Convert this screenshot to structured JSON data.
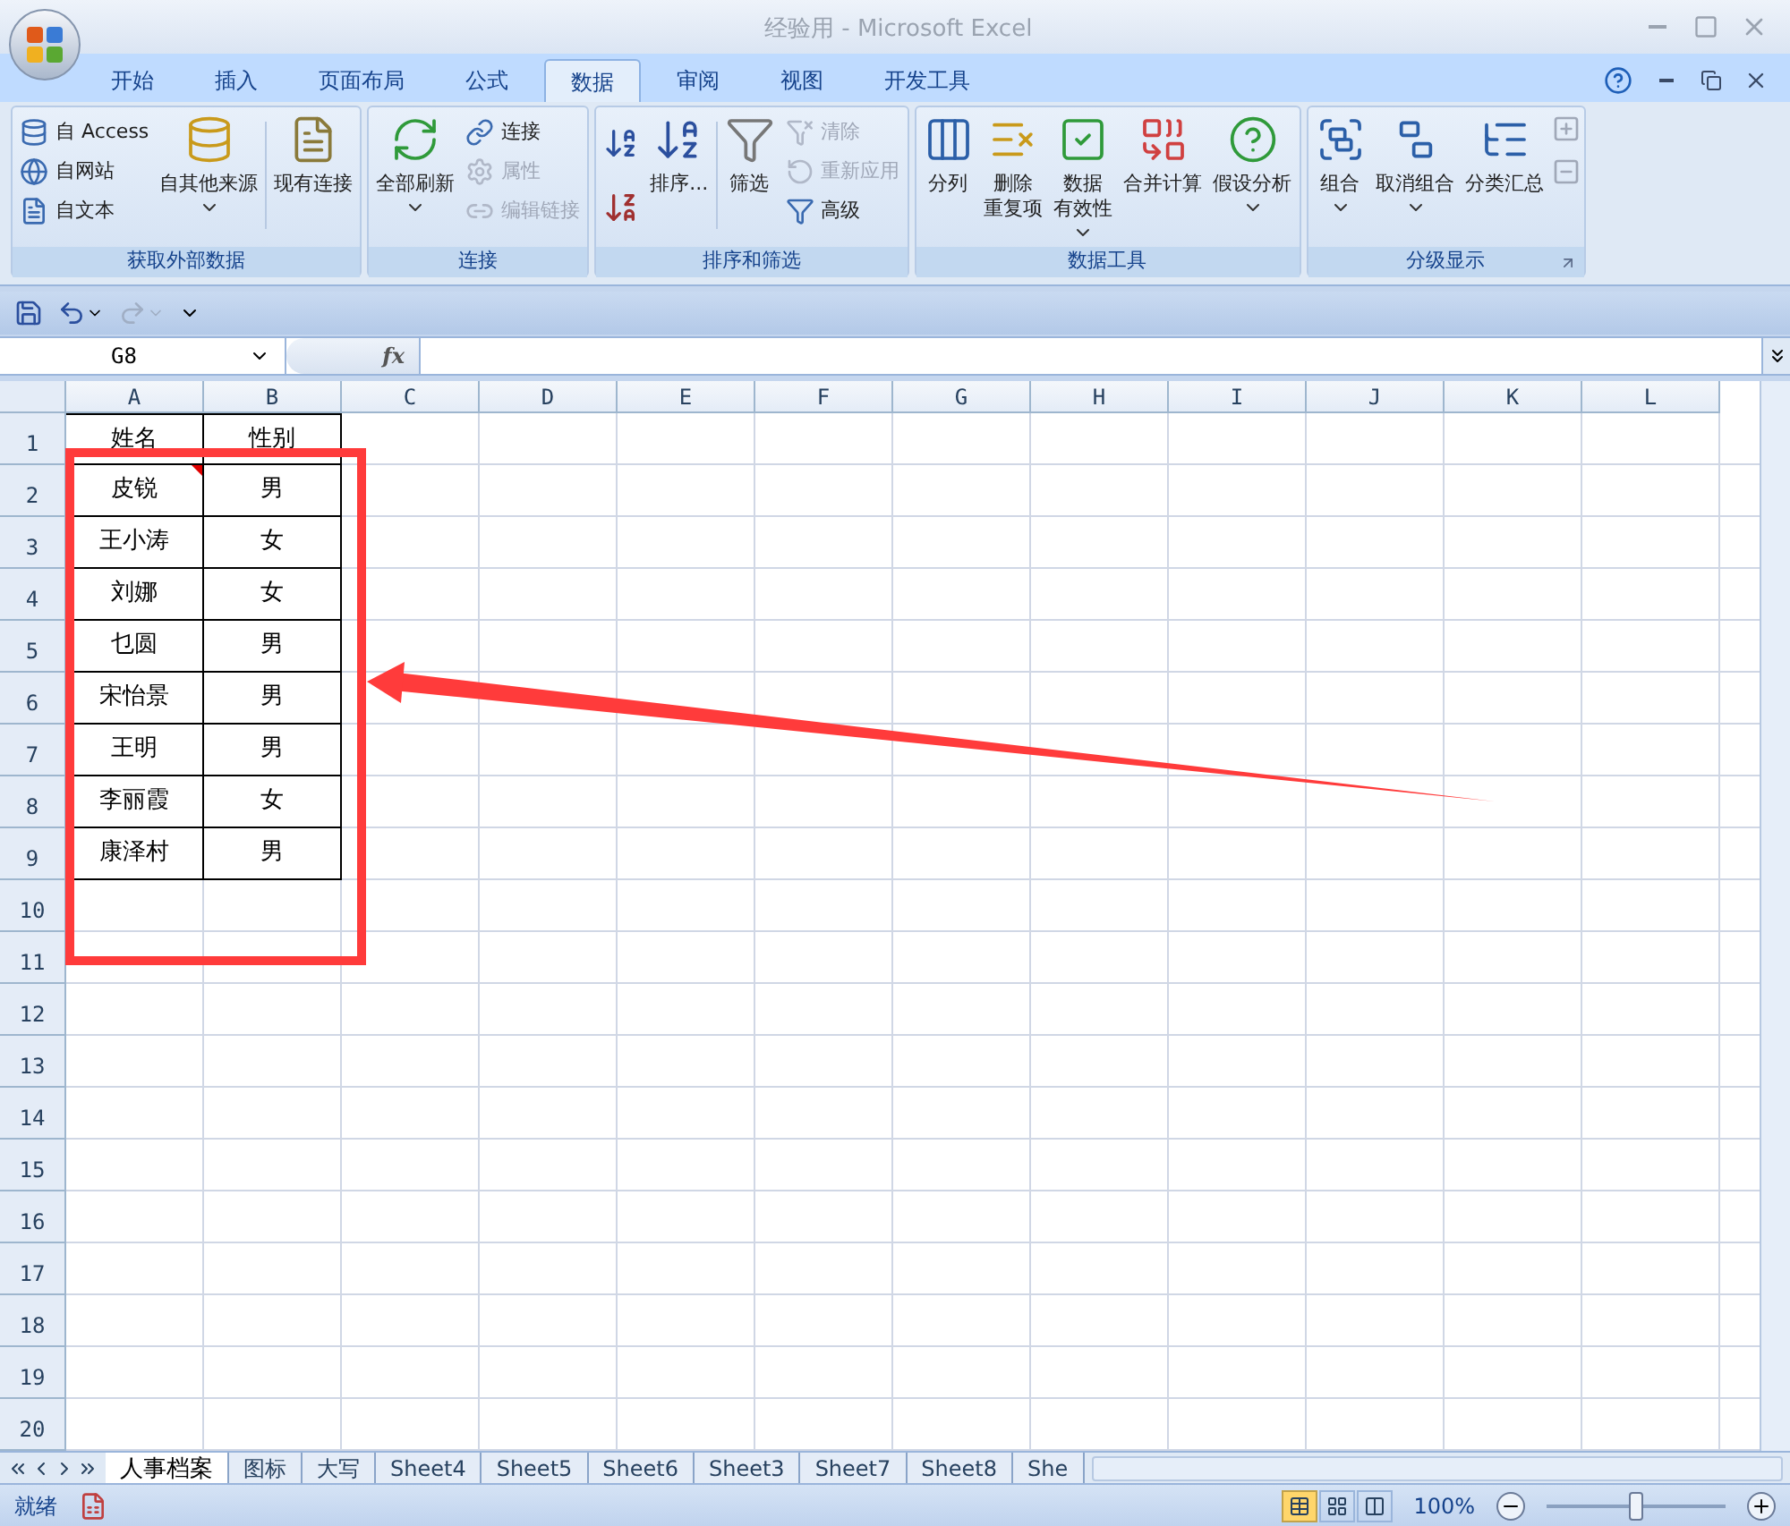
{
  "window": {
    "title": "经验用 - Microsoft Excel"
  },
  "tabs": [
    {
      "label": "开始",
      "selected": false
    },
    {
      "label": "插入",
      "selected": false
    },
    {
      "label": "页面布局",
      "selected": false
    },
    {
      "label": "公式",
      "selected": false
    },
    {
      "label": "数据",
      "selected": true
    },
    {
      "label": "审阅",
      "selected": false
    },
    {
      "label": "视图",
      "selected": false
    },
    {
      "label": "开发工具",
      "selected": false
    }
  ],
  "ribbon": {
    "groups": [
      {
        "title": "获取外部数据",
        "items": [
          {
            "kind": "small_stack",
            "items": [
              {
                "label": "自 Access",
                "disabled": false
              },
              {
                "label": "自网站",
                "disabled": false
              },
              {
                "label": "自文本",
                "disabled": false
              }
            ]
          },
          {
            "kind": "large",
            "lines": [
              "自其他来源"
            ],
            "dropdown": true
          },
          {
            "kind": "separator"
          },
          {
            "kind": "large",
            "lines": [
              "现有连接"
            ],
            "dropdown": false
          }
        ]
      },
      {
        "title": "连接",
        "items": [
          {
            "kind": "large",
            "lines": [
              "全部刷新"
            ],
            "dropdown": true
          },
          {
            "kind": "small_stack",
            "items": [
              {
                "label": "连接",
                "disabled": false
              },
              {
                "label": "属性",
                "disabled": true
              },
              {
                "label": "编辑链接",
                "disabled": true
              }
            ]
          }
        ]
      },
      {
        "title": "排序和筛选",
        "items": [
          {
            "kind": "sort_buttons"
          },
          {
            "kind": "large",
            "lines": [
              "排序..."
            ],
            "dropdown": false
          },
          {
            "kind": "separator"
          },
          {
            "kind": "large",
            "lines": [
              "筛选"
            ],
            "dropdown": false
          },
          {
            "kind": "small_stack",
            "items": [
              {
                "label": "清除",
                "disabled": true
              },
              {
                "label": "重新应用",
                "disabled": true
              },
              {
                "label": "高级",
                "disabled": false
              }
            ]
          }
        ]
      },
      {
        "title": "数据工具",
        "items": [
          {
            "kind": "large",
            "lines": [
              "分列"
            ],
            "dropdown": false
          },
          {
            "kind": "large",
            "lines": [
              "删除",
              "重复项"
            ],
            "dropdown": false
          },
          {
            "kind": "large",
            "lines": [
              "数据",
              "有效性"
            ],
            "dropdown": true
          },
          {
            "kind": "large",
            "lines": [
              "合并计算"
            ],
            "dropdown": false
          },
          {
            "kind": "large",
            "lines": [
              "假设分析"
            ],
            "dropdown": true
          }
        ]
      },
      {
        "title": "分级显示",
        "launcher": true,
        "items": [
          {
            "kind": "large",
            "lines": [
              "组合"
            ],
            "dropdown": true
          },
          {
            "kind": "large",
            "lines": [
              "取消组合"
            ],
            "dropdown": true
          },
          {
            "kind": "large",
            "lines": [
              "分类汇总"
            ],
            "dropdown": false
          },
          {
            "kind": "outline_buttons"
          }
        ]
      }
    ]
  },
  "formula_bar": {
    "name_box": "G8",
    "function_label": "fx"
  },
  "columns": [
    "A",
    "B",
    "C",
    "D",
    "E",
    "F",
    "G",
    "H",
    "I",
    "J",
    "K",
    "L"
  ],
  "rows": [
    {
      "number": "1",
      "cells": [
        {
          "text": "姓名",
          "comment": false
        },
        {
          "text": "性别",
          "comment": false
        }
      ]
    },
    {
      "number": "2",
      "cells": [
        {
          "text": "皮锐",
          "comment": true
        },
        {
          "text": "男",
          "comment": false
        }
      ]
    },
    {
      "number": "3",
      "cells": [
        {
          "text": "王小涛",
          "comment": false
        },
        {
          "text": "女",
          "comment": false
        }
      ]
    },
    {
      "number": "4",
      "cells": [
        {
          "text": "刘娜",
          "comment": false
        },
        {
          "text": "女",
          "comment": false
        }
      ]
    },
    {
      "number": "5",
      "cells": [
        {
          "text": "乜圆",
          "comment": false
        },
        {
          "text": "男",
          "comment": false
        }
      ]
    },
    {
      "number": "6",
      "cells": [
        {
          "text": "宋怡景",
          "comment": false
        },
        {
          "text": "男",
          "comment": false
        }
      ]
    },
    {
      "number": "7",
      "cells": [
        {
          "text": "王明",
          "comment": false
        },
        {
          "text": "男",
          "comment": false
        }
      ]
    },
    {
      "number": "8",
      "cells": [
        {
          "text": "李丽霞",
          "comment": false
        },
        {
          "text": "女",
          "comment": false
        }
      ]
    },
    {
      "number": "9",
      "cells": [
        {
          "text": "康泽村",
          "comment": false
        },
        {
          "text": "男",
          "comment": false
        }
      ]
    },
    {
      "number": "10"
    },
    {
      "number": "11"
    },
    {
      "number": "12"
    },
    {
      "number": "13"
    },
    {
      "number": "14"
    },
    {
      "number": "15"
    },
    {
      "number": "16"
    },
    {
      "number": "17"
    },
    {
      "number": "18"
    },
    {
      "number": "19"
    },
    {
      "number": "20"
    }
  ],
  "sheet_tabs": [
    {
      "label": "人事档案",
      "selected": true
    },
    {
      "label": "图标",
      "selected": false
    },
    {
      "label": "大写",
      "selected": false
    },
    {
      "label": "Sheet4",
      "selected": false
    },
    {
      "label": "Sheet5",
      "selected": false
    },
    {
      "label": "Sheet6",
      "selected": false
    },
    {
      "label": "Sheet3",
      "selected": false
    },
    {
      "label": "Sheet7",
      "selected": false
    },
    {
      "label": "Sheet8",
      "selected": false
    },
    {
      "label": "She",
      "selected": false
    }
  ],
  "status_bar": {
    "status": "就绪",
    "views": [
      {
        "selected": true
      },
      {
        "selected": false
      },
      {
        "selected": false
      }
    ],
    "zoom": "100%",
    "zoom_slider": {
      "level": 0.5
    }
  }
}
